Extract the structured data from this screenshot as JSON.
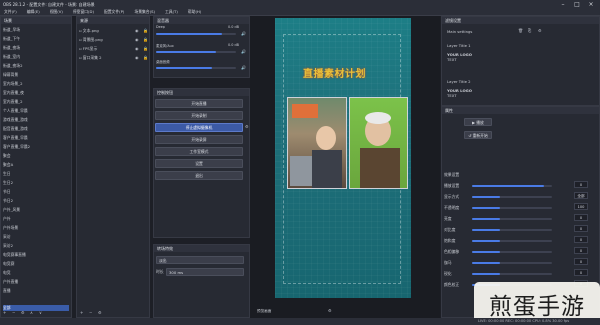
{
  "titlebar": {
    "title": "OBS 28.1.2 - 配置文件: 自建文件 - 场景: 自建场景"
  },
  "menubar": {
    "items": [
      "文件(F)",
      "编辑(E)",
      "视图(V)",
      "停靠窗口(D)",
      "配置文件(P)",
      "场景集合(S)",
      "工具(T)",
      "帮助(H)"
    ]
  },
  "scenes": {
    "header": "场景",
    "items": [
      "街道_早场",
      "街道_下午",
      "街道_夜场",
      "街道_室内",
      "街道_夜场2",
      "绿幕背景",
      "室内场景_2",
      "室内直播_夜",
      "室内直播_2",
      "个人直播_早晨",
      "游戏直播_游戏",
      "配音直播_游戏",
      "客户直播_早晨",
      "客户直播_早晨2",
      "聚会",
      "聚会A",
      "生日",
      "生日2",
      "节日",
      "节日2",
      "户外_风景",
      "户外",
      "户外场景",
      "采访",
      "采访2",
      "电竞赛事直播",
      "电竞赛",
      "电竞",
      "户外直播",
      "直播",
      "场景",
      "场景2",
      "场景3"
    ],
    "selected": "全部"
  },
  "sources": {
    "header": "来源",
    "items": [
      "文本.png",
      "背景图.png",
      "FPS显示",
      "窗口采集 2"
    ]
  },
  "mixer": {
    "header": "混音器",
    "channels": [
      {
        "name": "Deep",
        "db": "0.0 dB",
        "level": 0.82
      },
      {
        "name": "麦克风/Aux",
        "db": "0.0 dB",
        "level": 0.75
      },
      {
        "name": "桌面音频",
        "db": "0.0 dB",
        "level": 0.7
      }
    ]
  },
  "controls": {
    "header": "控制按钮",
    "buttons": [
      "开始直播",
      "开始录制",
      "停止虚拟摄像机",
      "开始录屏",
      "工作室模式",
      "设置",
      "退出"
    ],
    "active_index": 2
  },
  "transitions": {
    "header": "转场特效",
    "type": "淡出",
    "duration_label": "时长",
    "duration": "300 ms"
  },
  "preview": {
    "headline": "直播素材计划",
    "bottom_label": "预览画面"
  },
  "filters": {
    "header": "滤镜设置",
    "top_label": "Main settings",
    "items": [
      {
        "title": "Layer Title 1",
        "name": "YOUR LOGO",
        "sub": "TEXT"
      },
      {
        "title": "Layer Title 2",
        "name": "YOUR LOGO",
        "sub": "TEXT"
      }
    ]
  },
  "properties": {
    "header": "属性",
    "sections": [
      "效果设置"
    ],
    "rows": [
      {
        "label": "播放设置",
        "value": "0"
      },
      {
        "label": "显示方式",
        "value": "全部"
      },
      {
        "label": "不透明度",
        "value": "100"
      },
      {
        "label": "亮度",
        "value": "0"
      },
      {
        "label": "对比度",
        "value": "0"
      },
      {
        "label": "饱和度",
        "value": "0"
      },
      {
        "label": "色相偏移",
        "value": "0"
      },
      {
        "label": "伽马",
        "value": "0"
      },
      {
        "label": "锐化",
        "value": "0"
      },
      {
        "label": "颜色校正",
        "value": "0"
      }
    ]
  },
  "statusbar": {
    "text": "LIVE: 00:00:00  REC: 00:00:00  CPU: 0.8%  30.00 fps"
  }
}
